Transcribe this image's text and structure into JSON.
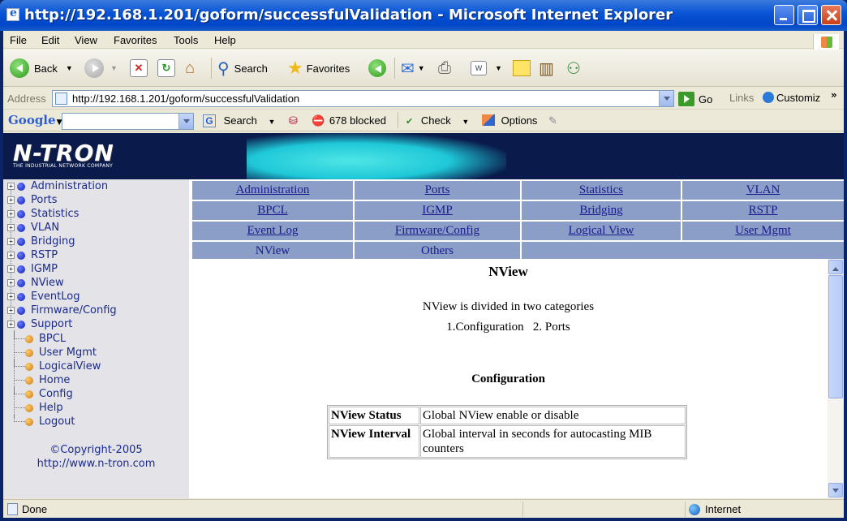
{
  "window": {
    "title": "http://192.168.1.201/goform/successfulValidation - Microsoft Internet Explorer"
  },
  "menubar": {
    "items": [
      "File",
      "Edit",
      "View",
      "Favorites",
      "Tools",
      "Help"
    ]
  },
  "toolbar": {
    "back_label": "Back",
    "search_label": "Search",
    "favorites_label": "Favorites"
  },
  "addressbar": {
    "label": "Address",
    "url": "http://192.168.1.201/goform/successfulValidation",
    "go_label": "Go",
    "links_label": "Links",
    "customize_label": "Customiz"
  },
  "googlebar": {
    "logo": "Google",
    "search_value": "",
    "search_label": "Search",
    "blocked_label": "678 blocked",
    "check_label": "Check",
    "options_label": "Options"
  },
  "banner": {
    "logo_text": "N-TRON",
    "logo_tagline": "THE INDUSTRIAL NETWORK COMPANY"
  },
  "tree": {
    "folders": [
      "Administration",
      "Ports",
      "Statistics",
      "VLAN",
      "Bridging",
      "RSTP",
      "IGMP",
      "NView",
      "EventLog",
      "Firmware/Config",
      "Support"
    ],
    "pages": [
      "BPCL",
      "User Mgmt",
      "LogicalView",
      "Home",
      "Config",
      "Help",
      "Logout"
    ],
    "copyright": "©Copyright-2005",
    "website": "http://www.n-tron.com"
  },
  "nav": {
    "rows": [
      [
        "Administration",
        "Ports",
        "Statistics",
        "VLAN"
      ],
      [
        "BPCL",
        "IGMP",
        "Bridging",
        "RSTP"
      ],
      [
        "Event Log",
        "Firmware/Config",
        "Logical View",
        "User Mgmt"
      ],
      [
        "NView",
        "Others"
      ]
    ]
  },
  "content": {
    "title": "NView",
    "intro": "NView is divided in two categories",
    "categories": "1.Configuration   2. Ports",
    "section_title": "Configuration",
    "table": [
      {
        "name": "NView Status",
        "desc": "Global NView enable or disable"
      },
      {
        "name": "NView Interval",
        "desc": "Global interval in seconds for autocasting MIB counters"
      }
    ]
  },
  "statusbar": {
    "status": "Done",
    "zone": "Internet"
  }
}
